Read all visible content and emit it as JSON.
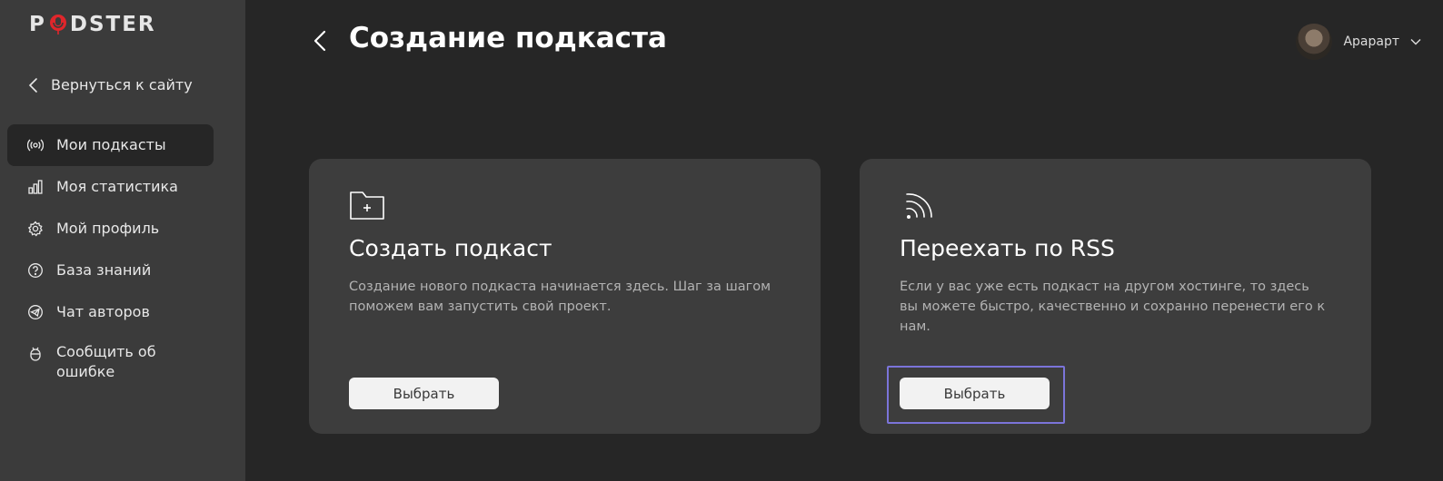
{
  "brand": {
    "logo_left": "P",
    "logo_right": "DSTER",
    "logo_accent": "#e0262b"
  },
  "sidebar": {
    "back_label": "Вернуться к сайту",
    "items": [
      {
        "label": "Мои подкасты",
        "icon": "podcast-broadcast-icon",
        "active": true
      },
      {
        "label": "Моя статистика",
        "icon": "bar-chart-icon"
      },
      {
        "label": "Мой профиль",
        "icon": "gear-icon"
      },
      {
        "label": "База знаний",
        "icon": "question-circle-icon"
      },
      {
        "label": "Чат авторов",
        "icon": "telegram-icon"
      },
      {
        "label": "Сообщить об ошибке",
        "icon": "bug-icon"
      }
    ]
  },
  "header": {
    "title": "Создание подкаста",
    "user_name": "Арарарт"
  },
  "cards": [
    {
      "icon": "folder-plus-icon",
      "title": "Создать подкаст",
      "description": "Создание нового подкаста начинается здесь. Шаг за шагом поможем вам запустить свой проект.",
      "button": "Выбрать"
    },
    {
      "icon": "rss-icon",
      "title": "Переехать по RSS",
      "description": "Если у вас уже есть подкаст на другом хостинге, то здесь вы можете быстро, качественно и сохранно перенести его к нам.",
      "button": "Выбрать"
    }
  ],
  "colors": {
    "sidebar_bg": "#3b3b3b",
    "main_bg": "#262626",
    "card_bg": "#3d3d3d",
    "focus_ring": "#7b74d9"
  }
}
